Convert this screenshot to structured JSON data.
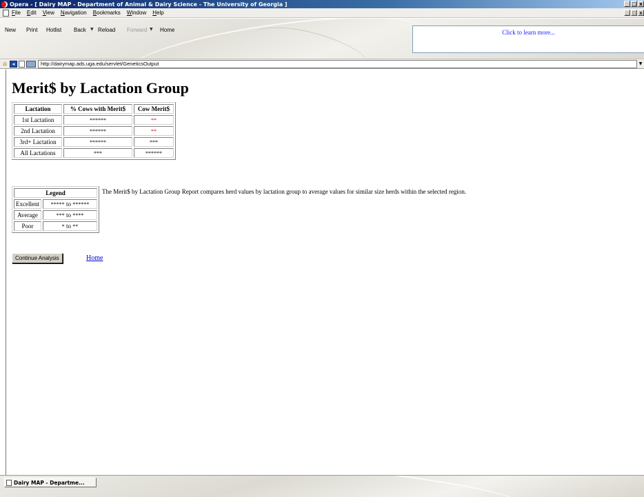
{
  "window": {
    "title": "Opera - [ Dairy MAP - Department of Animal & Dairy Science - The University of Georgia ]",
    "controls": [
      "_",
      "□",
      "x"
    ]
  },
  "menu": {
    "items": [
      "File",
      "Edit",
      "View",
      "Navigation",
      "Bookmarks",
      "Window",
      "Help"
    ]
  },
  "toolbar": {
    "new_label": "New",
    "print_label": "Print",
    "hotlist_label": "Hotlist",
    "back_label": "Back",
    "reload_label": "Reload",
    "forward_label": "Forward",
    "home_label": "Home",
    "ad_text": "Click to learn more..."
  },
  "address": {
    "url": "http://dairymap.ads.uga.edu/servlet/GeneticsOutput"
  },
  "page": {
    "title": "Merit$ by Lactation Group",
    "table": {
      "headers": [
        "Lactation",
        "% Cows with Merit$",
        "Cow Merit$"
      ],
      "rows": [
        {
          "lactation": "1st Lactation",
          "pct_cows": "******",
          "cow_merit": "**",
          "merit_color": "#e00000"
        },
        {
          "lactation": "2nd Lactation",
          "pct_cows": "******",
          "cow_merit": "**",
          "merit_color": "#e00000"
        },
        {
          "lactation": "3rd+ Lactation",
          "pct_cows": "******",
          "cow_merit": "***",
          "merit_color": "#000000"
        },
        {
          "lactation": "All Lactations",
          "pct_cows": "***",
          "cow_merit": "******",
          "merit_color": "#000000"
        }
      ]
    },
    "legend": {
      "header": "Legend",
      "rows": [
        {
          "label": "Excellent",
          "low": "*****",
          "sep": "to",
          "high": "******"
        },
        {
          "label": "Average",
          "low": "***",
          "sep": "to",
          "high": "****"
        },
        {
          "label": "Poor",
          "low": "*",
          "sep": "to",
          "high": "**"
        }
      ],
      "description": "The Merit$ by Lactation Group Report compares herd values by lactation group to average values for similar size herds within the selected region."
    },
    "continue_label": "Continue Analysis",
    "home_link": "Home"
  },
  "taskbar": {
    "task_label": "Dairy MAP - Departme..."
  }
}
